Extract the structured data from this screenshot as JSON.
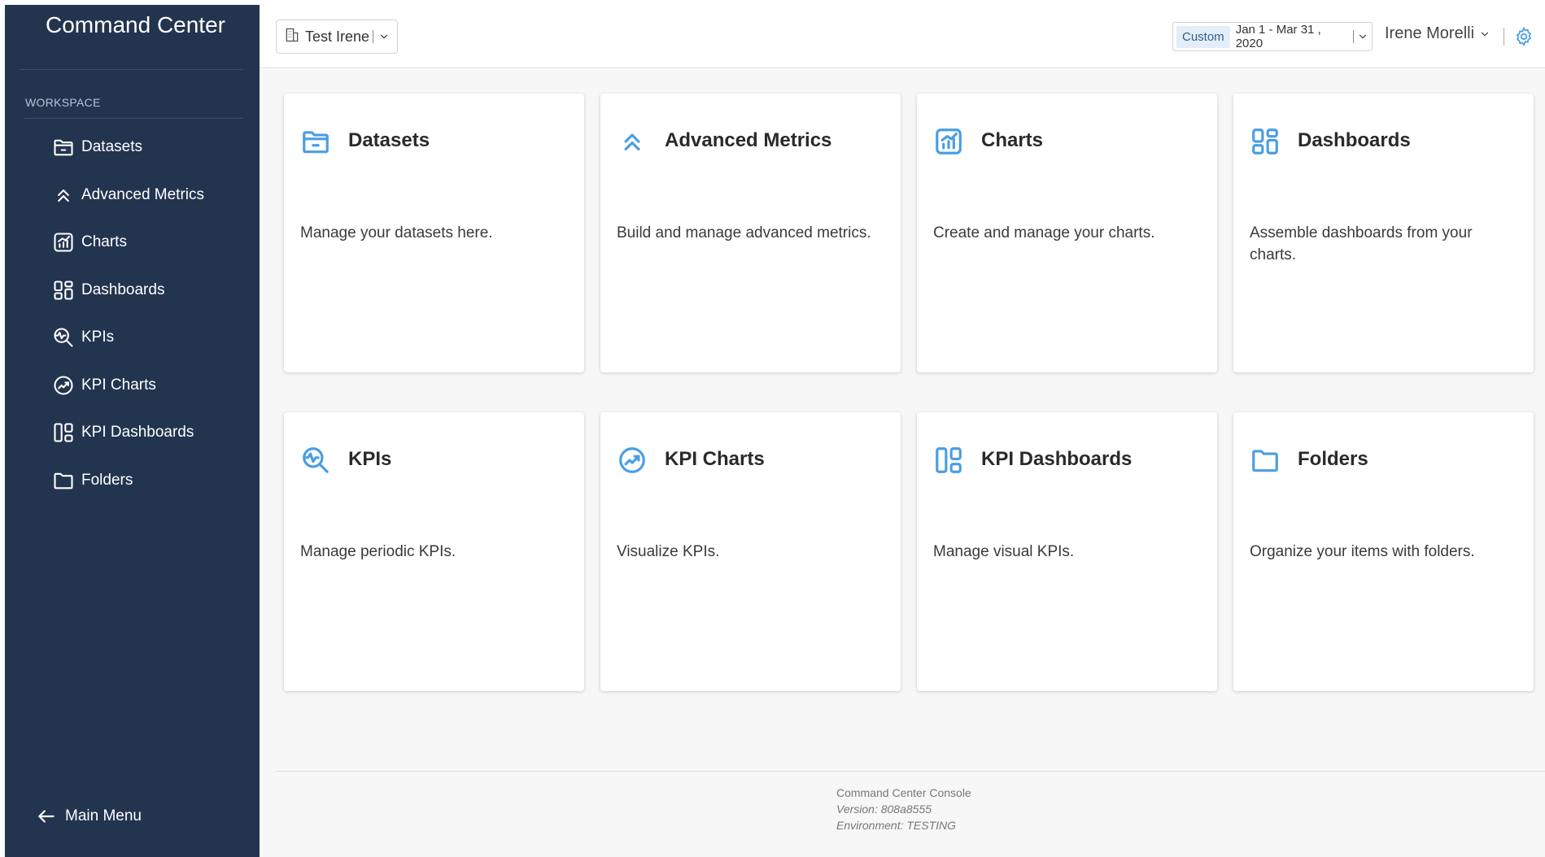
{
  "sidebar": {
    "brand": "Command Center",
    "section_label": "WORKSPACE",
    "items": [
      {
        "label": "Datasets",
        "icon": "folder-open-icon"
      },
      {
        "label": "Advanced Metrics",
        "icon": "double-chevron-up-icon"
      },
      {
        "label": "Charts",
        "icon": "chart-icon"
      },
      {
        "label": "Dashboards",
        "icon": "dashboard-icon"
      },
      {
        "label": "KPIs",
        "icon": "kpi-search-icon"
      },
      {
        "label": "KPI Charts",
        "icon": "kpi-chart-icon"
      },
      {
        "label": "KPI Dashboards",
        "icon": "kpi-dashboard-icon"
      },
      {
        "label": "Folders",
        "icon": "folder-icon"
      }
    ],
    "main_menu": "Main Menu"
  },
  "header": {
    "org": "Test Irene",
    "date_mode": "Custom",
    "date_range": "Jan 1 - Mar 31 , 2020",
    "user": "Irene Morelli"
  },
  "cards": [
    {
      "title": "Datasets",
      "desc": "Manage your datasets here.",
      "icon": "folder-open-icon"
    },
    {
      "title": "Advanced Metrics",
      "desc": "Build and manage advanced metrics.",
      "icon": "double-chevron-up-icon"
    },
    {
      "title": "Charts",
      "desc": "Create and manage your charts.",
      "icon": "chart-icon"
    },
    {
      "title": "Dashboards",
      "desc": "Assemble dashboards from your charts.",
      "icon": "dashboard-icon"
    },
    {
      "title": "KPIs",
      "desc": "Manage periodic KPIs.",
      "icon": "kpi-search-icon"
    },
    {
      "title": "KPI Charts",
      "desc": "Visualize KPIs.",
      "icon": "kpi-chart-icon"
    },
    {
      "title": "KPI Dashboards",
      "desc": "Manage visual KPIs.",
      "icon": "kpi-dashboard-icon"
    },
    {
      "title": "Folders",
      "desc": "Organize your items with folders.",
      "icon": "folder-icon"
    }
  ],
  "footer": {
    "name": "Command Center Console",
    "version": "Version: 808a8555",
    "environment": "Environment: TESTING"
  },
  "colors": {
    "sidebar_bg": "#23344f",
    "accent": "#4a9ee3",
    "main_bg": "#f7f7f7"
  }
}
